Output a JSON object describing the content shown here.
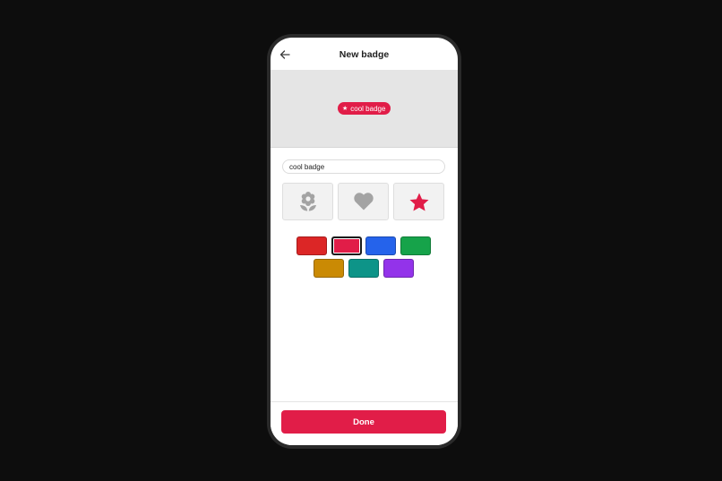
{
  "header": {
    "title": "New badge",
    "back_icon": "arrow-left-icon"
  },
  "preview": {
    "badge_label": "cool badge",
    "badge_icon": "star-icon",
    "badge_icon_glyph": "★",
    "badge_color": "#e11d48"
  },
  "form": {
    "name_value": "cool badge"
  },
  "icons": [
    {
      "name": "flower-icon",
      "selected": false
    },
    {
      "name": "heart-icon",
      "selected": false
    },
    {
      "name": "star-icon",
      "selected": true
    }
  ],
  "colors": {
    "inactive_icon": "#a3a3a3",
    "accent": "#e11d48",
    "swatches": [
      "#dc2626",
      "#e11d48",
      "#2563eb",
      "#16a34a",
      "#ca8a04",
      "#0d9488",
      "#9333ea"
    ],
    "selected_index": 1
  },
  "footer": {
    "done_label": "Done"
  }
}
